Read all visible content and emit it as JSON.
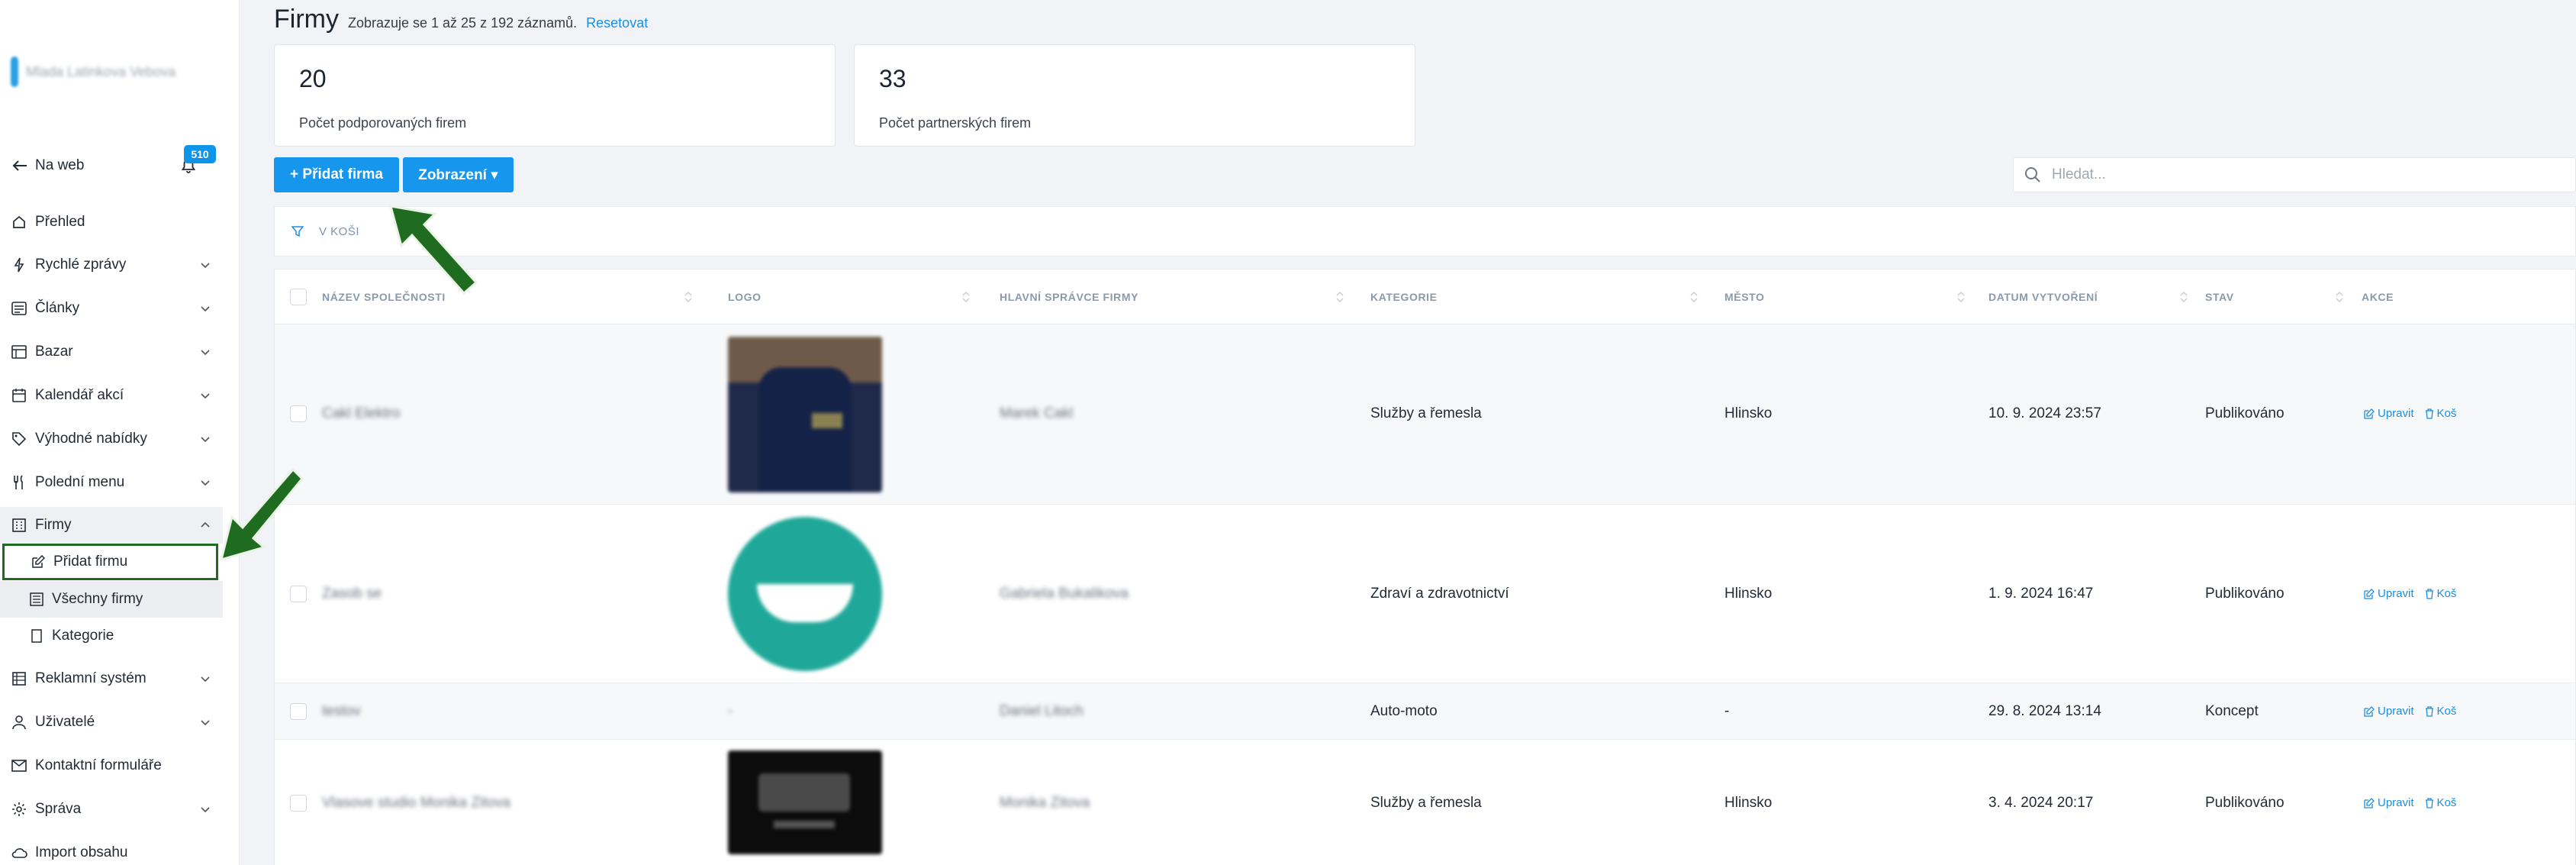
{
  "sidebar": {
    "user_name": "Mlada Latinkova Vebova",
    "back_label": "Na web",
    "notification_count": "510",
    "items": [
      {
        "label": "Přehled",
        "icon": "home-icon",
        "expandable": false
      },
      {
        "label": "Rychlé zprávy",
        "icon": "bolt-icon",
        "expandable": true
      },
      {
        "label": "Články",
        "icon": "article-icon",
        "expandable": true
      },
      {
        "label": "Bazar",
        "icon": "bazaar-icon",
        "expandable": true
      },
      {
        "label": "Kalendář akcí",
        "icon": "calendar-icon",
        "expandable": true
      },
      {
        "label": "Výhodné nabídky",
        "icon": "tag-icon",
        "expandable": true
      },
      {
        "label": "Polední menu",
        "icon": "cutlery-icon",
        "expandable": true
      },
      {
        "label": "Firmy",
        "icon": "building-icon",
        "expandable": true,
        "expanded": true
      },
      {
        "label": "Reklamní systém",
        "icon": "ads-icon",
        "expandable": true
      },
      {
        "label": "Uživatelé",
        "icon": "user-icon",
        "expandable": true
      },
      {
        "label": "Kontaktní formuláře",
        "icon": "mail-icon",
        "expandable": false
      },
      {
        "label": "Správa",
        "icon": "gear-icon",
        "expandable": true
      },
      {
        "label": "Import obsahu",
        "icon": "cloud-icon",
        "expandable": false
      }
    ],
    "firmy_sub": [
      {
        "label": "Přidat firmu",
        "icon": "edit-icon"
      },
      {
        "label": "Všechny firmy",
        "icon": "list-icon"
      },
      {
        "label": "Kategorie",
        "icon": "bookmark-icon"
      }
    ]
  },
  "page": {
    "title": "Firmy",
    "subtitle": "Zobrazuje se 1 až 25 z 192 záznamů.",
    "reset_label": "Resetovat"
  },
  "stats": [
    {
      "value": "20",
      "label": "Počet podporovaných firem"
    },
    {
      "value": "33",
      "label": "Počet partnerských firem"
    }
  ],
  "toolbar": {
    "add_label": "+ Přidat firma",
    "view_label": "Zobrazení ▾",
    "search_placeholder": "Hledat..."
  },
  "filter": {
    "label": "V KOŠI"
  },
  "table": {
    "columns": [
      "NÁZEV SPOLEČNOSTI",
      "LOGO",
      "HLAVNÍ SPRÁVCE FIRMY",
      "KATEGORIE",
      "MĚSTO",
      "DATUM VYTVOŘENÍ",
      "STAV",
      "AKCE"
    ],
    "rows": [
      {
        "name": "Cakl Elektro",
        "logo": "shirt-logo",
        "admin": "Marek Cakl",
        "category": "Služby a řemesla",
        "city": "Hlinsko",
        "date": "10. 9. 2024 23:57",
        "status": "Publikováno"
      },
      {
        "name": "Zasob se",
        "logo": "smile-logo",
        "admin": "Gabriela Bukalikova",
        "category": "Zdraví a zdravotnictví",
        "city": "Hlinsko",
        "date": "1. 9. 2024 16:47",
        "status": "Publikováno"
      },
      {
        "name": "testov",
        "logo": "-",
        "admin": "Daniel Litoch",
        "category": "Auto-moto",
        "city": "-",
        "date": "29. 8. 2024 13:14",
        "status": "Koncept"
      },
      {
        "name": "Vlasove studio Monika Zitova",
        "logo": "dark-logo",
        "admin": "Monika Zitova",
        "category": "Služby a řemesla",
        "city": "Hlinsko",
        "date": "3. 4. 2024 20:17",
        "status": "Publikováno"
      }
    ],
    "edit_label": "Upravit",
    "trash_label": "Koš"
  },
  "colors": {
    "accent": "#1696ec",
    "annotation": "#1f6b1f"
  }
}
